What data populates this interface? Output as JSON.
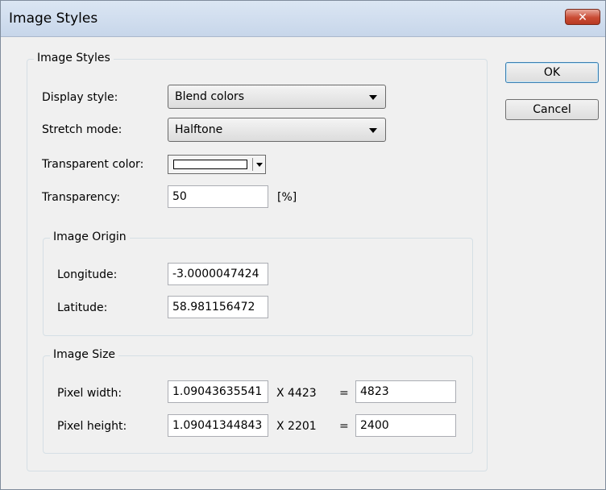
{
  "window": {
    "title": "Image Styles",
    "close_glyph": "✕"
  },
  "buttons": {
    "ok": "OK",
    "cancel": "Cancel"
  },
  "image_styles": {
    "group_label": "Image Styles",
    "display_style": {
      "label": "Display style:",
      "value": "Blend colors"
    },
    "stretch_mode": {
      "label": "Stretch mode:",
      "value": "Halftone"
    },
    "transparent_color": {
      "label": "Transparent color:",
      "swatch": "#ffffff"
    },
    "transparency": {
      "label": "Transparency:",
      "value": "50",
      "unit": "[%]"
    }
  },
  "image_origin": {
    "group_label": "Image Origin",
    "longitude": {
      "label": "Longitude:",
      "value": "-3.0000047424"
    },
    "latitude": {
      "label": "Latitude:",
      "value": "58.981156472"
    }
  },
  "image_size": {
    "group_label": "Image Size",
    "pixel_width": {
      "label": "Pixel width:",
      "scale": "1.09043635541",
      "op": "X 4423",
      "eq": "=",
      "result": "4823"
    },
    "pixel_height": {
      "label": "Pixel height:",
      "scale": "1.09041344843",
      "op": "X 2201",
      "eq": "=",
      "result": "2400"
    }
  }
}
